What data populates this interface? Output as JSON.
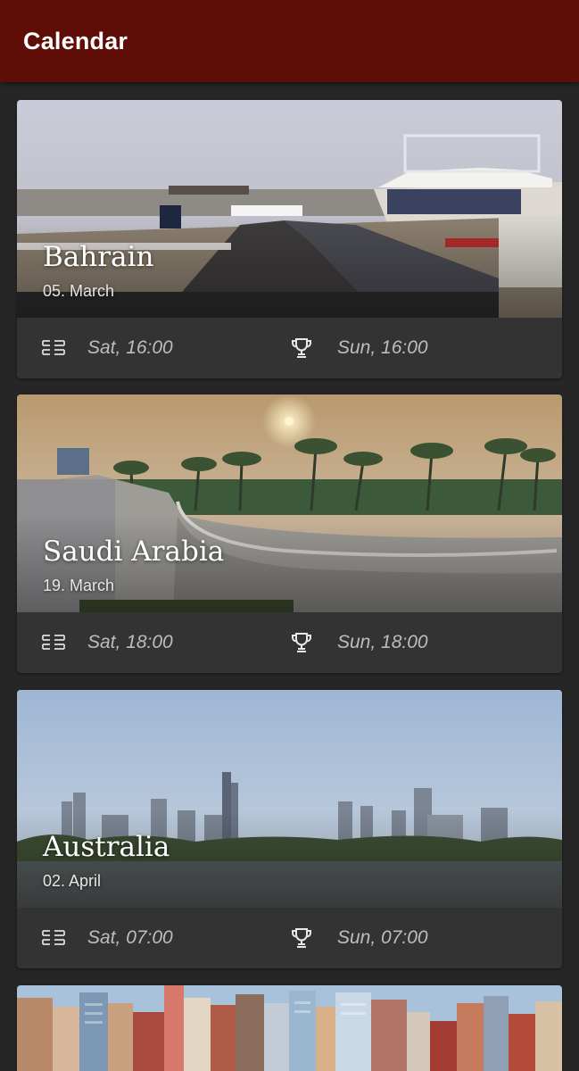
{
  "appbar": {
    "title": "Calendar"
  },
  "races": [
    {
      "country": "Bahrain",
      "date": "05. March",
      "qualifying": "Sat, 16:00",
      "race": "Sun, 16:00"
    },
    {
      "country": "Saudi Arabia",
      "date": "19. March",
      "qualifying": "Sat, 18:00",
      "race": "Sun, 18:00"
    },
    {
      "country": "Australia",
      "date": "02. April",
      "qualifying": "Sat, 07:00",
      "race": "Sun, 07:00"
    }
  ],
  "icons": {
    "qualifying": "starting-grid-icon",
    "race": "trophy-icon"
  },
  "colors": {
    "appbar": "#5e0d07",
    "background": "#262626",
    "card": "#333333",
    "secondary_text": "#bdbdbd"
  }
}
